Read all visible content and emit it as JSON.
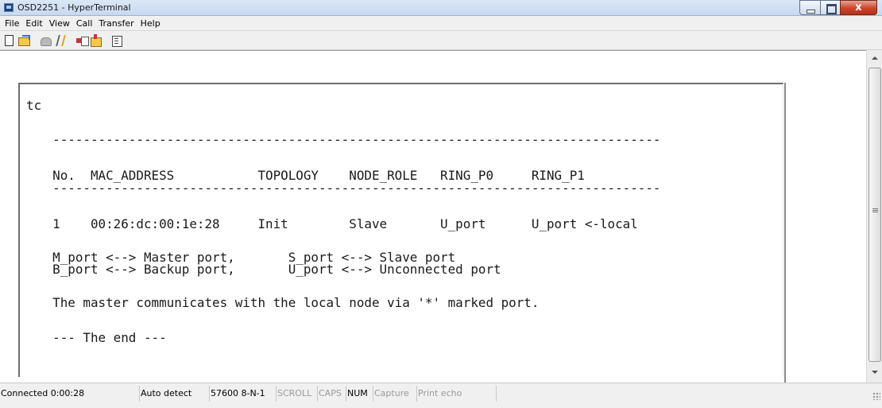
{
  "window": {
    "title": "OSD2251 - HyperTerminal",
    "close_glyph": "x"
  },
  "menu": [
    "File",
    "Edit",
    "View",
    "Call",
    "Transfer",
    "Help"
  ],
  "toolbar": {
    "icons": [
      "new-icon",
      "open-icon",
      "phone-icon",
      "disconnect-icon",
      "send-icon",
      "receive-icon",
      "properties-icon"
    ]
  },
  "terminal": {
    "lines": [
      "tc",
      "  --------------------------------------------------------------------------------",
      "  No.  MAC_ADDRESS           TOPOLOGY    NODE_ROLE   RING_P0     RING_P1",
      "  --------------------------------------------------------------------------------",
      "  1    00:26:dc:00:1e:28     Init        Slave       U_port      U_port <-local",
      "  M_port <--> Master port,       S_port <--> Slave port",
      "  B_port <--> Backup port,       U_port <--> Unconnected port",
      "  The master communicates with the local node via '*' marked port.",
      "  --- The end ---"
    ]
  },
  "statusbar": {
    "connected": "Connected 0:00:28",
    "detect": "Auto detect",
    "settings": "57600 8-N-1",
    "scroll": "SCROLL",
    "caps": "CAPS",
    "num": "NUM",
    "capture": "Capture",
    "print_echo": "Print echo"
  }
}
